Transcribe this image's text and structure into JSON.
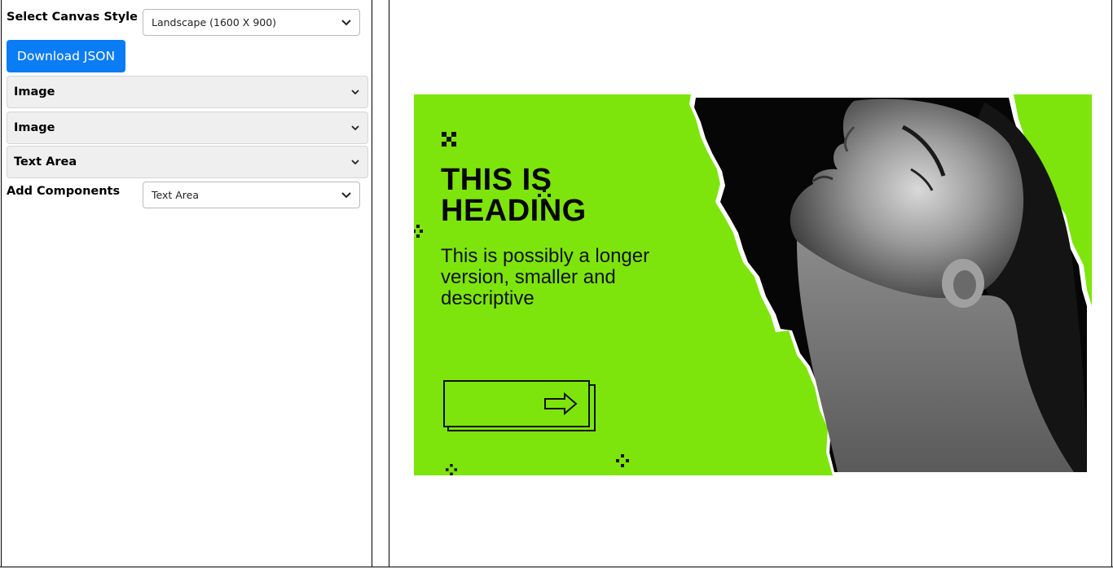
{
  "left_panel": {
    "canvas_style_label": "Select Canvas Style",
    "canvas_style_value": "Landscape (1600 X 900)",
    "download_button": "Download JSON",
    "accordions": [
      {
        "label": "Image"
      },
      {
        "label": "Image"
      },
      {
        "label": "Text Area"
      }
    ],
    "add_components_label": "Add Components",
    "add_components_value": "Text Area"
  },
  "canvas": {
    "background_color": "#7de50c",
    "heading": "THIS IS\nHEADING",
    "subtext": "This is possibly a longer version, smaller and descriptive",
    "cta_icon": "arrow-right-icon"
  },
  "colors": {
    "primary_button": "#0a7cf5",
    "accordion_bg": "#efefef"
  }
}
